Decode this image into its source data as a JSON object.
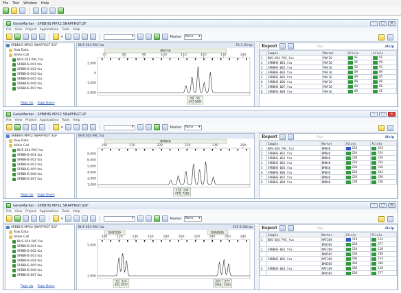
{
  "outer_menu": [
    "File",
    "Tool",
    "Window",
    "Help"
  ],
  "windows": [
    {
      "title": "GeneMarker - SPBBHS MPX2 SNAPFRGT.GF",
      "menu": [
        "File",
        "View",
        "Project",
        "Applications",
        "Tools",
        "Help"
      ],
      "marker_label": "Marker",
      "marker_value": "None",
      "tree": [
        "SPBBHS MPX2 SNAPFRGT SGF",
        "Raw Data",
        "Allele Call",
        "BHS 054 PAC fsa",
        "SPBBHS 001 fsa",
        "SPBBHS 002 fsa",
        "SPBBHS 003 fsa",
        "SPBBHS 005 fsa",
        "SPBBHS 006 fsa",
        "SPBBHS 007 fsa"
      ],
      "page_up": "Page Up",
      "page_down": "Page Down",
      "chart_file": "BHS 054 PAC fsa",
      "chart_header_right": "70.3 (0) bp",
      "report_title": "Report",
      "report_dim": "Dye",
      "report_help": "Help",
      "report_cols": [
        "",
        "Sample",
        "Marker",
        "Allele",
        "Allele"
      ],
      "report_rows": [
        [
          "1",
          "BHS-054 PAC_fsa",
          "MAF36",
          "91",
          "91"
        ],
        [
          "2",
          "SPBBHS-001.fsa",
          "MAF36",
          "95",
          "99"
        ],
        [
          "3",
          "SPBBHS-002.fsa",
          "MAF36",
          "93",
          "93"
        ],
        [
          "4",
          "SPBBHS-003.fsa",
          "MAF36",
          "89",
          "89"
        ],
        [
          "5",
          "SPBBHS-005.fsa",
          "MAF36",
          "89",
          "95"
        ],
        [
          "6",
          "SPBBHS-006.fsa",
          "MAF36",
          "89",
          "89"
        ],
        [
          "7",
          "SPBBHS-007.fsa",
          "MAF36",
          "89",
          "89"
        ],
        [
          "8",
          "SPBBHS-008.fsa",
          "MAF36",
          "89",
          "91"
        ]
      ],
      "chart_data": {
        "type": "line",
        "marker_bins": [
          "MAF36"
        ],
        "x_ticks": [
          "70",
          "80",
          "90",
          "100",
          "110",
          "120",
          "130",
          "140"
        ],
        "y_ticks": [
          "2,000",
          "0",
          "-1,000",
          "-2,000"
        ],
        "peak_labels": [
          [
            "89",
            "2474"
          ],
          [
            "95",
            "1684"
          ]
        ]
      }
    },
    {
      "title": "GeneMarker - SPBBHS MPX2 SNAPFRGT.GF",
      "menu": [
        "File",
        "View",
        "Project",
        "Applications",
        "Tools",
        "Help"
      ],
      "marker_label": "Marker",
      "marker_value": "None",
      "tree": [
        "SPBBHS MPX2 SNAPFRGT SGF",
        "Raw Data",
        "Allele Call",
        "BHS 054 PAC fsa",
        "SPBBHS 001 fsa",
        "SPBBHS 002 fsa",
        "SPBBHS 003 fsa",
        "SPBBHS 005 fsa",
        "SPBBHS 006 fsa",
        "SPBBHS 007 fsa"
      ],
      "page_up": "Page Up",
      "page_down": "Page Down",
      "chart_file": "BHS 054 PAC fsa",
      "chart_header_right": "",
      "report_title": "Report",
      "report_dim": "Dye",
      "report_help": "Help",
      "report_cols": [
        "",
        "Sample",
        "Marker",
        "Allele",
        "Allele"
      ],
      "report_rows": [
        [
          "1",
          "BHS-054 PAC_fsa",
          "BM848",
          "226",
          "234"
        ],
        [
          "2",
          "SPBBHS-001.fsa",
          "BM848",
          "234",
          "234"
        ],
        [
          "3",
          "SPBBHS-002.fsa",
          "BM848",
          "230",
          "236"
        ],
        [
          "4",
          "SPBBHS-003.fsa",
          "BM848",
          "234",
          "244"
        ],
        [
          "5",
          "SPBBHS-005.fsa",
          "BM848",
          "236",
          "236"
        ],
        [
          "6",
          "SPBBHS-006.fsa",
          "BM848",
          "236",
          "244"
        ],
        [
          "7",
          "SPBBHS-007.fsa",
          "BM848",
          "228",
          "236"
        ],
        [
          "8",
          "SPBBHS-008.fsa",
          "BM848",
          "230",
          "236"
        ]
      ],
      "chart_data": {
        "type": "line",
        "marker_bins": [
          "BM848"
        ],
        "x_ticks": [
          "200",
          "210",
          "220",
          "230",
          "240",
          "250"
        ],
        "y_ticks": [
          "8,000",
          "6,000",
          "5,000",
          "4,000",
          "2,000",
          "1,000"
        ],
        "peak_labels": [
          [
            "232",
            "4735"
          ],
          [
            "234",
            "7285"
          ]
        ]
      }
    },
    {
      "title": "GeneMarker - SPBBHS MPX1 SNAPFRGT.SGF",
      "menu": [
        "File",
        "View",
        "Project",
        "Applications",
        "Tools",
        "Help"
      ],
      "marker_label": "Marker",
      "marker_value": "None",
      "tree": [
        "SPBBHS MPX2 SNAPFRGT SGF",
        "Raw Data",
        "Allele Call",
        "BHS 054 PAC fsa",
        "SPBBHS 001 fsa",
        "SPBBHS 002 fsa",
        "SPBBHS 003 fsa",
        "SPBBHS 004 fsa",
        "SPBBHS 005 fsa",
        "SPBBHS 006 fsa",
        "SPBBHS 007 fsa"
      ],
      "page_up": "Page Up",
      "page_down": "Page Down",
      "chart_file": "BHS 054 PAC fsa",
      "chart_header_right": "239.5(38) bp",
      "report_title": "Report",
      "report_dim": "Dye",
      "report_help": "Help",
      "report_cols": [
        "",
        "Sample",
        "Marker",
        "Allele",
        "Allele"
      ],
      "report_rows": [
        [
          "1",
          "BHS-054 PAC_fsa",
          "MAF209",
          "114",
          "114"
        ],
        [
          "",
          "",
          "BM4505",
          "268",
          "277"
        ],
        [
          "2",
          "SPBBHS-001.fsa",
          "MAF209",
          "110",
          "110"
        ],
        [
          "",
          "",
          "BM4505",
          "268",
          "268"
        ],
        [
          "3",
          "SPBBHS-002.fsa",
          "MAF209",
          "106",
          "114"
        ],
        [
          "",
          "",
          "BM4505",
          "268",
          "268"
        ],
        [
          "4",
          "SPBBHS-003.fsa",
          "MAF209",
          "108",
          "110"
        ],
        [
          "",
          "",
          "BM4505",
          "268",
          "277"
        ]
      ],
      "chart_data": {
        "type": "line",
        "marker_bins": [
          "BHF209",
          "BM4505"
        ],
        "x_ticks": [
          "100",
          "120",
          "140",
          "160",
          "180",
          "200",
          "220",
          "240",
          "260",
          "280"
        ],
        "y_ticks": [
          "5,000",
          "2,000"
        ],
        "peak_labels": [
          [
            "110",
            "4834"
          ],
          [
            "114",
            "3977"
          ],
          [
            "267",
            "1958"
          ],
          [
            "277",
            "1300"
          ]
        ]
      }
    }
  ]
}
